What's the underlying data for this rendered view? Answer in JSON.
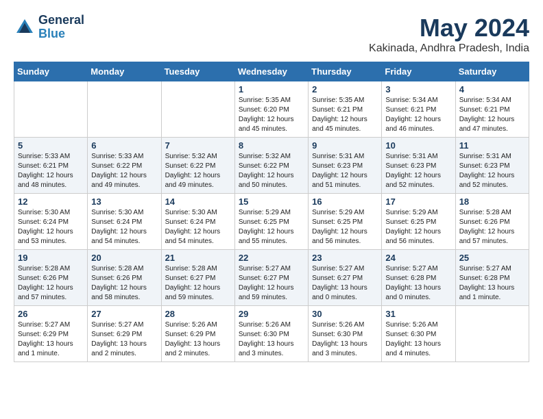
{
  "header": {
    "logo_line1": "General",
    "logo_line2": "Blue",
    "month_title": "May 2024",
    "location": "Kakinada, Andhra Pradesh, India"
  },
  "weekdays": [
    "Sunday",
    "Monday",
    "Tuesday",
    "Wednesday",
    "Thursday",
    "Friday",
    "Saturday"
  ],
  "weeks": [
    [
      {
        "day": "",
        "info": ""
      },
      {
        "day": "",
        "info": ""
      },
      {
        "day": "",
        "info": ""
      },
      {
        "day": "1",
        "info": "Sunrise: 5:35 AM\nSunset: 6:20 PM\nDaylight: 12 hours\nand 45 minutes."
      },
      {
        "day": "2",
        "info": "Sunrise: 5:35 AM\nSunset: 6:21 PM\nDaylight: 12 hours\nand 45 minutes."
      },
      {
        "day": "3",
        "info": "Sunrise: 5:34 AM\nSunset: 6:21 PM\nDaylight: 12 hours\nand 46 minutes."
      },
      {
        "day": "4",
        "info": "Sunrise: 5:34 AM\nSunset: 6:21 PM\nDaylight: 12 hours\nand 47 minutes."
      }
    ],
    [
      {
        "day": "5",
        "info": "Sunrise: 5:33 AM\nSunset: 6:21 PM\nDaylight: 12 hours\nand 48 minutes."
      },
      {
        "day": "6",
        "info": "Sunrise: 5:33 AM\nSunset: 6:22 PM\nDaylight: 12 hours\nand 49 minutes."
      },
      {
        "day": "7",
        "info": "Sunrise: 5:32 AM\nSunset: 6:22 PM\nDaylight: 12 hours\nand 49 minutes."
      },
      {
        "day": "8",
        "info": "Sunrise: 5:32 AM\nSunset: 6:22 PM\nDaylight: 12 hours\nand 50 minutes."
      },
      {
        "day": "9",
        "info": "Sunrise: 5:31 AM\nSunset: 6:23 PM\nDaylight: 12 hours\nand 51 minutes."
      },
      {
        "day": "10",
        "info": "Sunrise: 5:31 AM\nSunset: 6:23 PM\nDaylight: 12 hours\nand 52 minutes."
      },
      {
        "day": "11",
        "info": "Sunrise: 5:31 AM\nSunset: 6:23 PM\nDaylight: 12 hours\nand 52 minutes."
      }
    ],
    [
      {
        "day": "12",
        "info": "Sunrise: 5:30 AM\nSunset: 6:24 PM\nDaylight: 12 hours\nand 53 minutes."
      },
      {
        "day": "13",
        "info": "Sunrise: 5:30 AM\nSunset: 6:24 PM\nDaylight: 12 hours\nand 54 minutes."
      },
      {
        "day": "14",
        "info": "Sunrise: 5:30 AM\nSunset: 6:24 PM\nDaylight: 12 hours\nand 54 minutes."
      },
      {
        "day": "15",
        "info": "Sunrise: 5:29 AM\nSunset: 6:25 PM\nDaylight: 12 hours\nand 55 minutes."
      },
      {
        "day": "16",
        "info": "Sunrise: 5:29 AM\nSunset: 6:25 PM\nDaylight: 12 hours\nand 56 minutes."
      },
      {
        "day": "17",
        "info": "Sunrise: 5:29 AM\nSunset: 6:25 PM\nDaylight: 12 hours\nand 56 minutes."
      },
      {
        "day": "18",
        "info": "Sunrise: 5:28 AM\nSunset: 6:26 PM\nDaylight: 12 hours\nand 57 minutes."
      }
    ],
    [
      {
        "day": "19",
        "info": "Sunrise: 5:28 AM\nSunset: 6:26 PM\nDaylight: 12 hours\nand 57 minutes."
      },
      {
        "day": "20",
        "info": "Sunrise: 5:28 AM\nSunset: 6:26 PM\nDaylight: 12 hours\nand 58 minutes."
      },
      {
        "day": "21",
        "info": "Sunrise: 5:28 AM\nSunset: 6:27 PM\nDaylight: 12 hours\nand 59 minutes."
      },
      {
        "day": "22",
        "info": "Sunrise: 5:27 AM\nSunset: 6:27 PM\nDaylight: 12 hours\nand 59 minutes."
      },
      {
        "day": "23",
        "info": "Sunrise: 5:27 AM\nSunset: 6:27 PM\nDaylight: 13 hours\nand 0 minutes."
      },
      {
        "day": "24",
        "info": "Sunrise: 5:27 AM\nSunset: 6:28 PM\nDaylight: 13 hours\nand 0 minutes."
      },
      {
        "day": "25",
        "info": "Sunrise: 5:27 AM\nSunset: 6:28 PM\nDaylight: 13 hours\nand 1 minute."
      }
    ],
    [
      {
        "day": "26",
        "info": "Sunrise: 5:27 AM\nSunset: 6:29 PM\nDaylight: 13 hours\nand 1 minute."
      },
      {
        "day": "27",
        "info": "Sunrise: 5:27 AM\nSunset: 6:29 PM\nDaylight: 13 hours\nand 2 minutes."
      },
      {
        "day": "28",
        "info": "Sunrise: 5:26 AM\nSunset: 6:29 PM\nDaylight: 13 hours\nand 2 minutes."
      },
      {
        "day": "29",
        "info": "Sunrise: 5:26 AM\nSunset: 6:30 PM\nDaylight: 13 hours\nand 3 minutes."
      },
      {
        "day": "30",
        "info": "Sunrise: 5:26 AM\nSunset: 6:30 PM\nDaylight: 13 hours\nand 3 minutes."
      },
      {
        "day": "31",
        "info": "Sunrise: 5:26 AM\nSunset: 6:30 PM\nDaylight: 13 hours\nand 4 minutes."
      },
      {
        "day": "",
        "info": ""
      }
    ]
  ]
}
